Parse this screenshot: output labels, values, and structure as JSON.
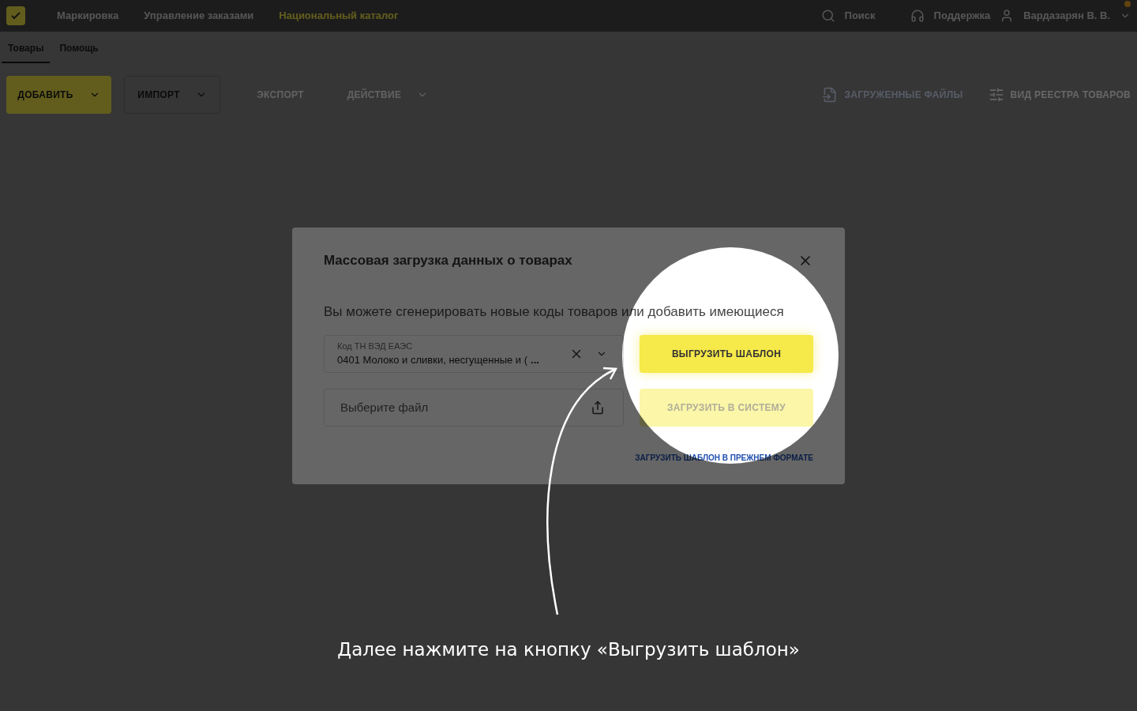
{
  "nav": {
    "items": [
      {
        "label": "Маркировка",
        "selected": false
      },
      {
        "label": "Управление заказами",
        "selected": false
      },
      {
        "label": "Национальный каталог",
        "selected": true
      }
    ],
    "search": "Поиск",
    "support": "Поддержка",
    "user": "Вардазарян В. В."
  },
  "tabs": [
    {
      "label": "Товары",
      "selected": true
    },
    {
      "label": "Помощь",
      "selected": false
    }
  ],
  "toolbar": [
    {
      "label": "ДОБАВИТЬ",
      "kind": "primary",
      "dropdown": true,
      "disabled": false
    },
    {
      "label": "ИМПОРТ",
      "kind": "outline",
      "dropdown": true,
      "disabled": false
    },
    {
      "label": "ЭКСПОРТ",
      "kind": "text",
      "dropdown": false,
      "disabled": true
    },
    {
      "label": "ДЕЙСТВИЕ",
      "kind": "text",
      "dropdown": true,
      "disabled": true
    }
  ],
  "toolbar_right": [
    {
      "label": "ЗАГРУЖЕННЫЕ ФАЙЛЫ",
      "disabled": false
    },
    {
      "label": "ВИД РЕЕСТРА ТОВАРОВ",
      "disabled": true
    }
  ],
  "dialog": {
    "title": "Массовая загрузка данных о товарах",
    "description": "Вы можете сгенерировать новые коды товаров или добавить имеющиеся",
    "code_field": {
      "label": "Код ТН ВЭД ЕАЭС",
      "value": "0401 Молоко и сливки, несгущенные и (",
      "more": "..."
    },
    "file_field": {
      "placeholder": "Выберите файл"
    },
    "buttons": [
      {
        "label": "ВЫГРУЗИТЬ ШАБЛОН",
        "disabled": false
      },
      {
        "label": "ЗАГРУЗИТЬ В СИСТЕМУ",
        "disabled": true
      }
    ],
    "link": "ЗАГРУЗИТЬ ШАБЛОН В ПРЕЖНЕМ ФОРМАТЕ"
  },
  "caption": "Далее нажмите на кнопку «Выгрузить шаблон»"
}
